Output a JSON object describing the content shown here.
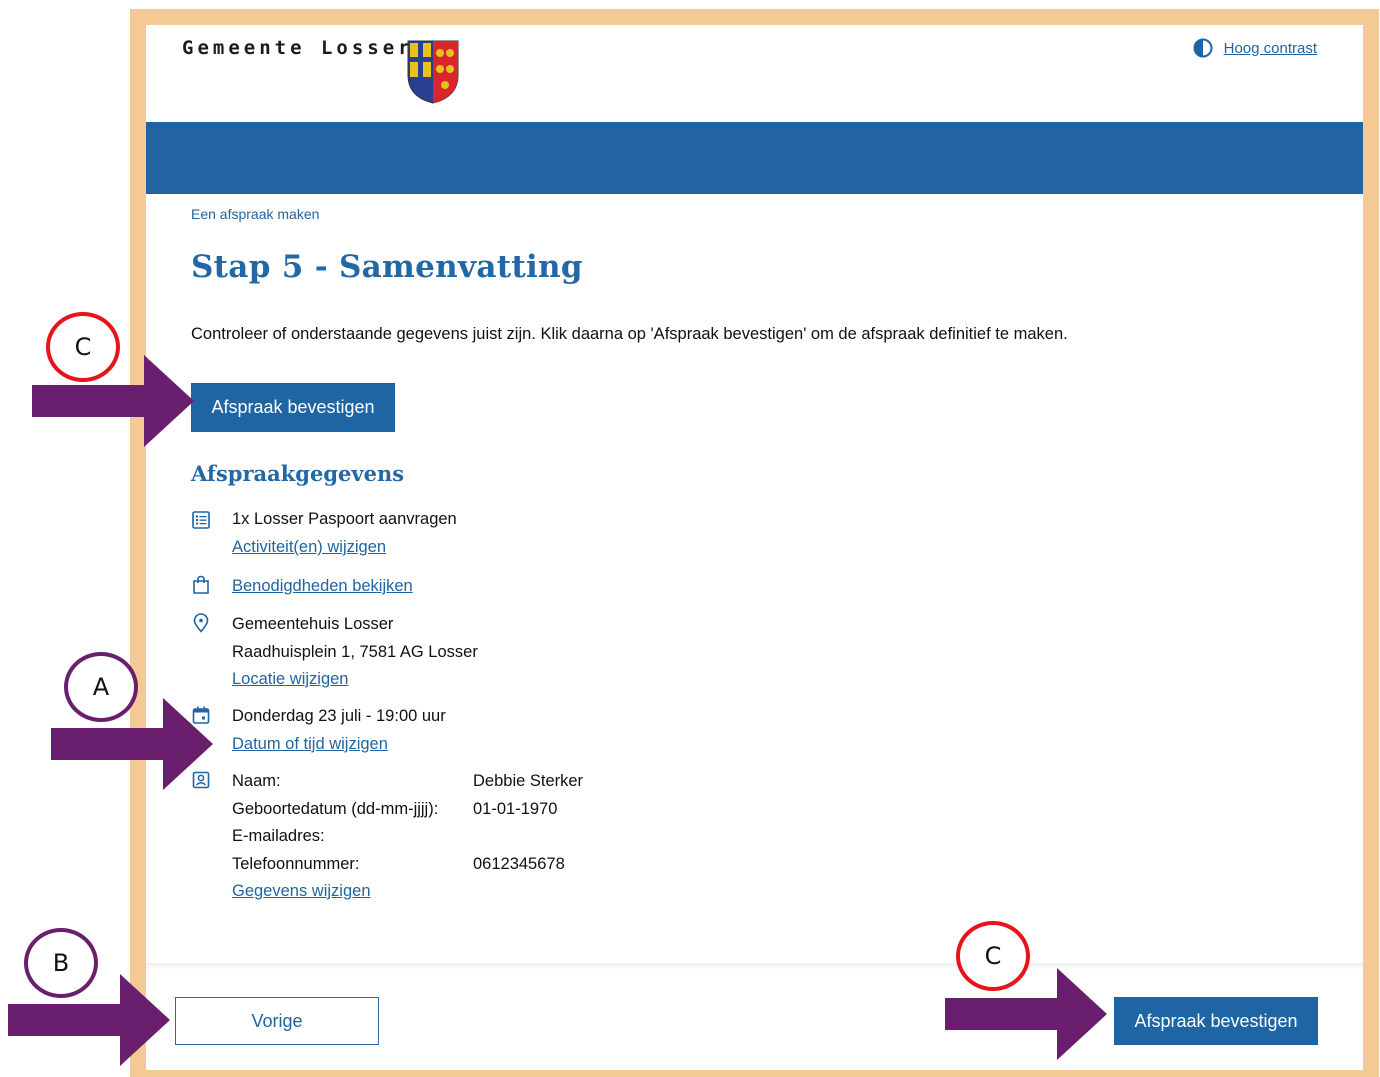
{
  "header": {
    "brand": "Gemeente Losser",
    "contrast_link": "Hoog contrast"
  },
  "breadcrumb": "Een afspraak maken",
  "page_title": "Stap 5 - Samenvatting",
  "intro": "Controleer of onderstaande gegevens juist zijn. Klik daarna op 'Afspraak bevestigen' om de afspraak definitief te maken.",
  "buttons": {
    "confirm_top": "Afspraak bevestigen",
    "confirm_bottom": "Afspraak bevestigen",
    "previous": "Vorige"
  },
  "section_title": "Afspraakgegevens",
  "activity": {
    "text": "1x Losser Paspoort aanvragen",
    "link": "Activiteit(en) wijzigen"
  },
  "requirements_link": "Benodigdheden bekijken",
  "location": {
    "name": "Gemeentehuis Losser",
    "address": "Raadhuisplein 1, 7581 AG Losser",
    "link": "Locatie wijzigen"
  },
  "datetime": {
    "text": "Donderdag 23 juli - 19:00 uur",
    "link": "Datum of tijd wijzigen"
  },
  "personal": {
    "name_label": "Naam:",
    "name_value": "Debbie Sterker",
    "dob_label": "Geboortedatum (dd-mm-jjjj):",
    "dob_value": "01-01-1970",
    "email_label": "E-mailadres:",
    "email_value": "",
    "phone_label": "Telefoonnummer:",
    "phone_value": "0612345678",
    "link": "Gegevens wijzigen"
  },
  "annotations": {
    "a": "A",
    "b": "B",
    "c_top": "C",
    "c_bottom": "C"
  },
  "colors": {
    "brand_blue": "#1f64a3",
    "frame": "#f5c994",
    "arrow_purple": "#6a1f6e",
    "badge_red": "#e8141b"
  }
}
